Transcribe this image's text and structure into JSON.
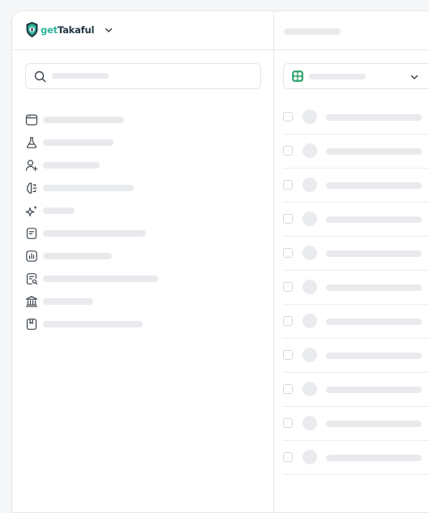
{
  "brand": {
    "name_prefix": "get",
    "name_main": "Takaful",
    "colors": {
      "accent": "#2bb39a",
      "dark": "#1f3442"
    }
  },
  "search": {
    "placeholder": "",
    "value": ""
  },
  "sidebar": {
    "items": [
      {
        "icon": "browser-window-icon",
        "label": "",
        "placeholder_width": 100
      },
      {
        "icon": "flask-icon",
        "label": "",
        "placeholder_width": 87
      },
      {
        "icon": "user-add-icon",
        "label": "",
        "placeholder_width": 70
      },
      {
        "icon": "brain-icon",
        "label": "",
        "placeholder_width": 112
      },
      {
        "icon": "sparkles-icon",
        "label": "",
        "placeholder_width": 39
      },
      {
        "icon": "document-icon",
        "label": "",
        "placeholder_width": 127
      },
      {
        "icon": "bar-chart-icon",
        "label": "",
        "placeholder_width": 85
      },
      {
        "icon": "document-search-icon",
        "label": "",
        "placeholder_width": 142
      },
      {
        "icon": "bank-icon",
        "label": "",
        "placeholder_width": 62
      },
      {
        "icon": "book-icon",
        "label": "",
        "placeholder_width": 123
      }
    ]
  },
  "right_panel": {
    "title": "",
    "filter": {
      "icon": "grid-icon",
      "label": "",
      "accent_color": "#3aa874"
    },
    "rows": [
      {
        "label": ""
      },
      {
        "label": ""
      },
      {
        "label": ""
      },
      {
        "label": ""
      },
      {
        "label": ""
      },
      {
        "label": ""
      },
      {
        "label": ""
      },
      {
        "label": ""
      },
      {
        "label": ""
      },
      {
        "label": ""
      },
      {
        "label": ""
      }
    ]
  }
}
